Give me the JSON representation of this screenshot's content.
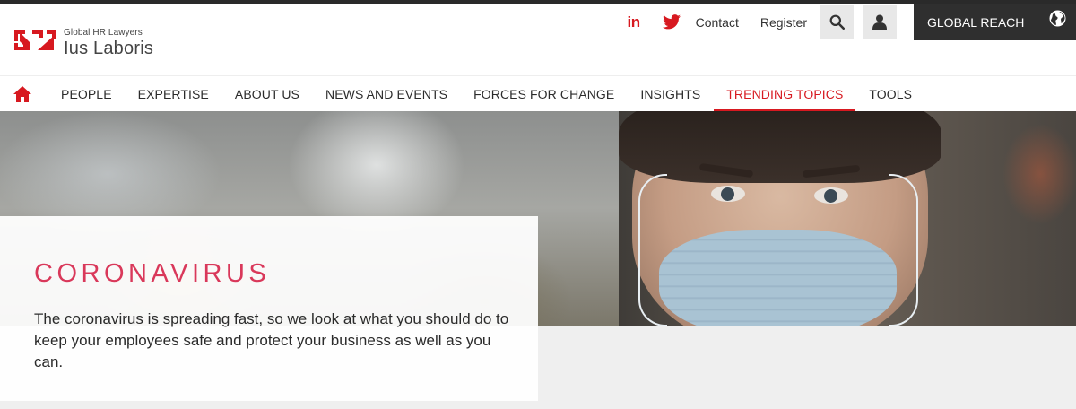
{
  "brand": {
    "tagline": "Global HR Lawyers",
    "name": "Ius Laboris",
    "accent_color": "#d71920"
  },
  "utility": {
    "linkedin_label": "in",
    "twitter_icon": "twitter-icon",
    "contact": "Contact",
    "register": "Register",
    "search_icon": "search-icon",
    "account_icon": "user-icon",
    "global_reach": "GLOBAL REACH",
    "globe_icon": "globe-icon"
  },
  "nav": {
    "home_icon": "home-icon",
    "items": [
      {
        "label": "PEOPLE"
      },
      {
        "label": "EXPERTISE"
      },
      {
        "label": "ABOUT US"
      },
      {
        "label": "NEWS AND EVENTS"
      },
      {
        "label": "FORCES FOR CHANGE"
      },
      {
        "label": "INSIGHTS"
      },
      {
        "label": "TRENDING TOPICS",
        "active": true
      },
      {
        "label": "TOOLS"
      }
    ]
  },
  "hero": {
    "title": "CORONAVIRUS",
    "text": "The coronavirus is spreading fast, so we look at what you should do to keep your employees safe and protect your business as well as you can.",
    "title_color": "#d9385a"
  }
}
